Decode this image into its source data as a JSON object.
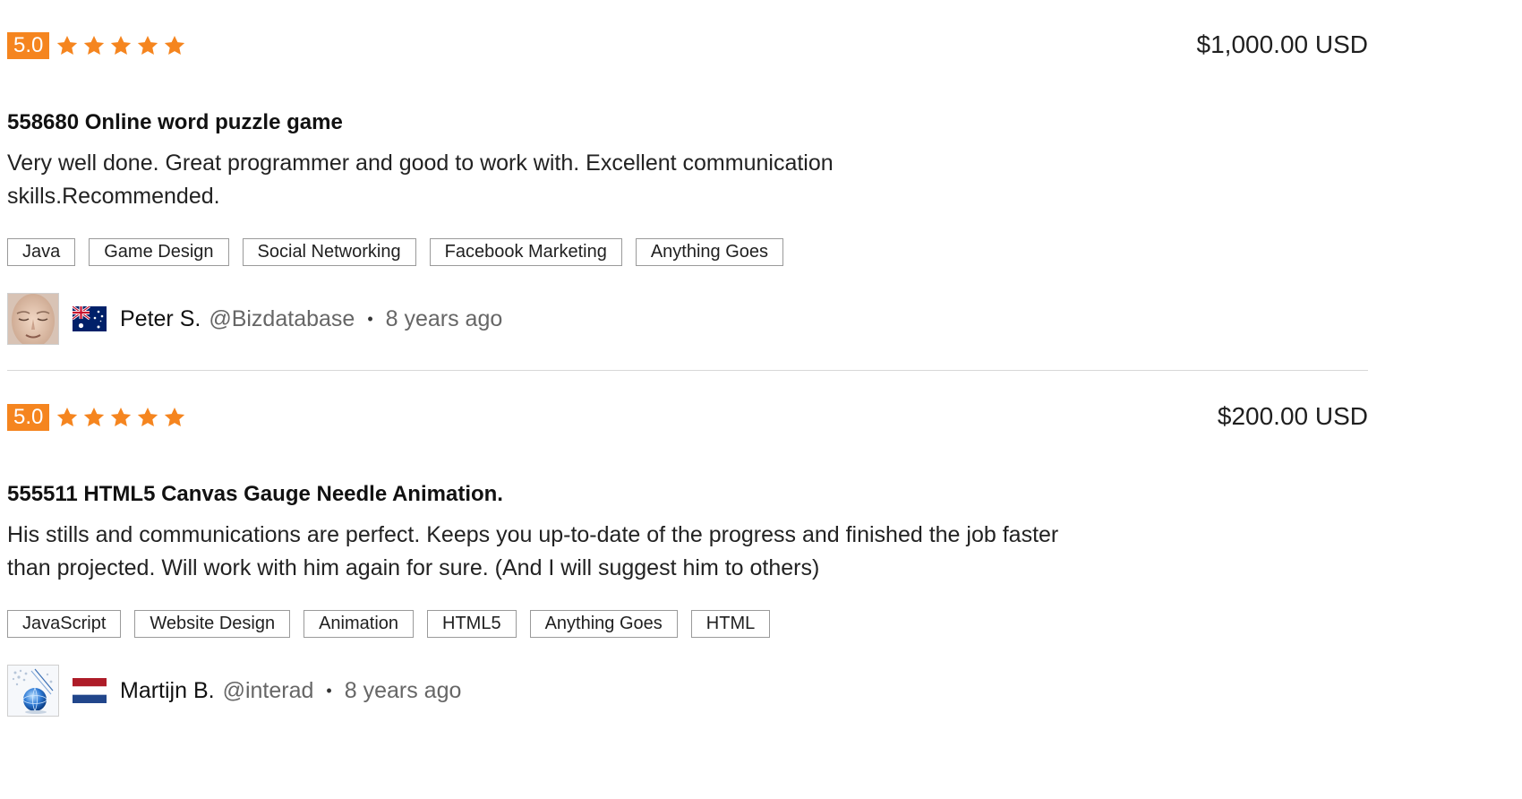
{
  "colors": {
    "accent": "#f5851f",
    "star": "#f5851f",
    "text": "#1f1f1f",
    "muted": "#666666",
    "divider": "#d8d8d8"
  },
  "reviews": [
    {
      "rating": "5.0",
      "stars": 5,
      "price": "$1,000.00 USD",
      "title": "558680 Online word puzzle game",
      "comment": "Very well done. Great programmer and good to work with. Excellent communication skills.Recommended.",
      "tags": [
        "Java",
        "Game Design",
        "Social Networking",
        "Facebook Marketing",
        "Anything Goes"
      ],
      "reviewer": {
        "name": "Peter S.",
        "handle": "@Bizdatabase",
        "separator": "•",
        "time": "8 years ago",
        "flag": "australia-flag-icon",
        "avatar": "face-avatar"
      }
    },
    {
      "rating": "5.0",
      "stars": 5,
      "price": "$200.00 USD",
      "title": "555511 HTML5 Canvas Gauge Needle Animation.",
      "comment": "His stills and communications are perfect. Keeps you up-to-date of the progress and finished the job faster than projected. Will work with him again for sure. (And I will suggest him to others)",
      "tags": [
        "JavaScript",
        "Website Design",
        "Animation",
        "HTML5",
        "Anything Goes",
        "HTML"
      ],
      "reviewer": {
        "name": "Martijn B.",
        "handle": "@interad",
        "separator": "•",
        "time": "8 years ago",
        "flag": "netherlands-flag-icon",
        "avatar": "globe-avatar"
      }
    }
  ]
}
